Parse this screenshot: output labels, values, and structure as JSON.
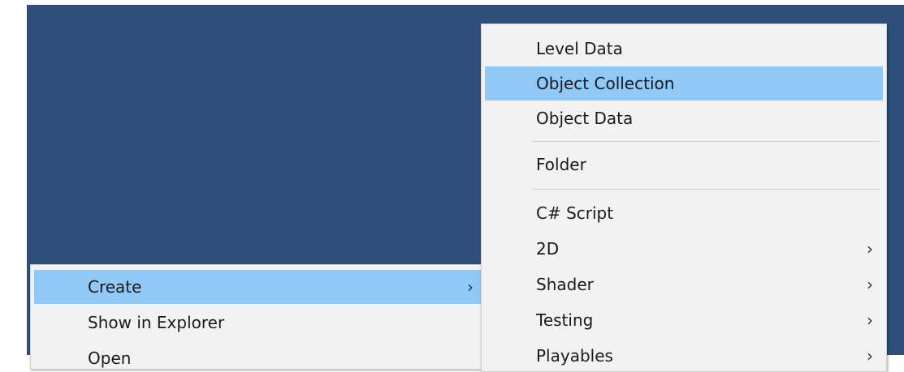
{
  "left_menu": {
    "items": [
      {
        "label": "Create",
        "arrow": "›"
      },
      {
        "label": "Show in Explorer"
      },
      {
        "label": "Open"
      }
    ]
  },
  "create_submenu": {
    "items": [
      {
        "label": "Level Data"
      },
      {
        "label": "Object Collection"
      },
      {
        "label": "Object Data"
      },
      {
        "label": "Folder"
      },
      {
        "label": "C# Script"
      },
      {
        "label": "2D",
        "arrow": "›"
      },
      {
        "label": "Shader",
        "arrow": "›"
      },
      {
        "label": "Testing",
        "arrow": "›"
      },
      {
        "label": "Playables",
        "arrow": "›"
      }
    ]
  },
  "colors": {
    "background": "#2f4f7a",
    "menu_bg": "#f2f2f2",
    "highlight": "#90c8f6"
  },
  "icons": [
    "chevron-right-icon"
  ]
}
